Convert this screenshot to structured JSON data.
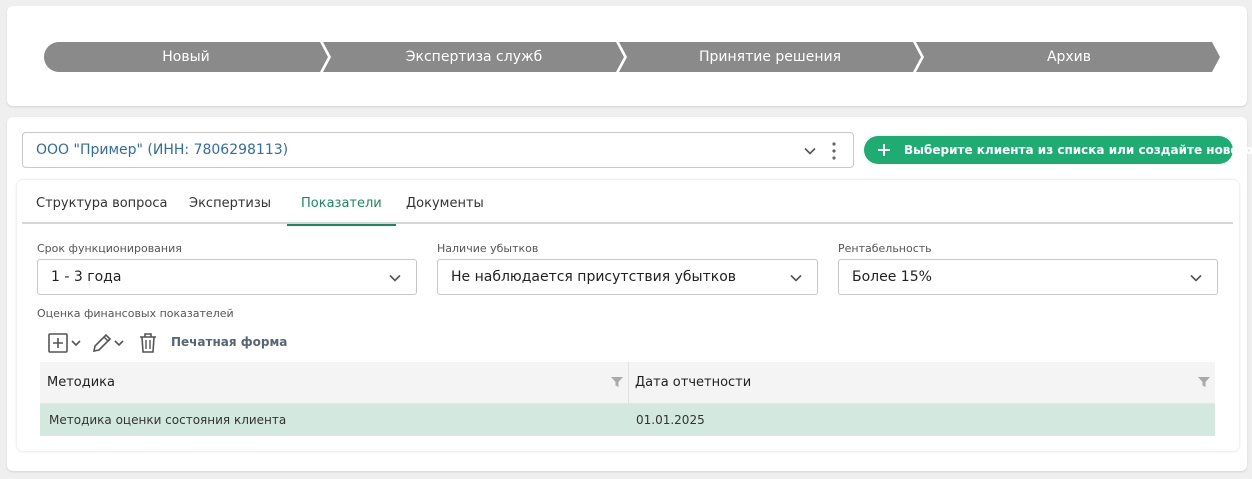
{
  "stages": [
    "Новый",
    "Экспертиза служб",
    "Принятие решения",
    "Архив"
  ],
  "colors": {
    "stage_bg": "#8a8a8a",
    "accent": "#1fac72",
    "tab_active": "#1a8a5d",
    "row_selected": "#d3e9e0",
    "link": "#2f6da8"
  },
  "client": {
    "value": "ООО \"Пример\" (ИНН: 7806298113)",
    "create_label": "Выберите клиента из списка или создайте нового"
  },
  "tabs": [
    "Структура вопроса",
    "Экспертизы",
    "Показатели",
    "Документы"
  ],
  "active_tab": "Показатели",
  "fields": {
    "term": {
      "label": "Срок функционирования",
      "value": "1 - 3 года"
    },
    "losses": {
      "label": "Наличие убытков",
      "value": "Не наблюдается присутствия убытков"
    },
    "profit": {
      "label": "Рентабельность",
      "value": "Более 15%"
    }
  },
  "section_label": "Оценка финансовых показателей",
  "toolbar": {
    "print_label": "Печатная форма"
  },
  "grid": {
    "columns": [
      "Методика",
      "Дата отчетности"
    ],
    "rows": [
      {
        "method": "Методика оценки состояния клиента",
        "date": "01.01.2025"
      }
    ]
  }
}
